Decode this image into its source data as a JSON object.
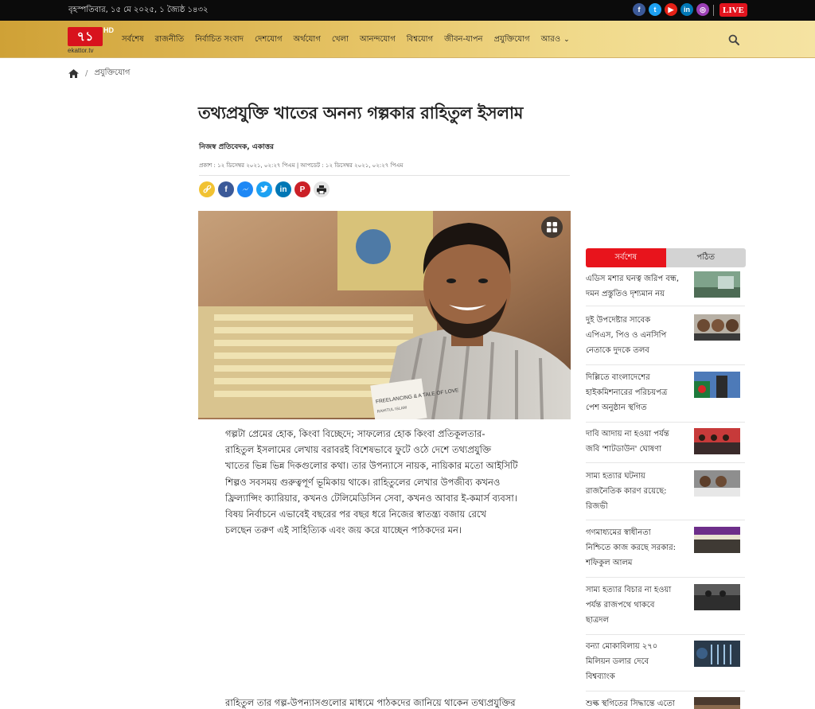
{
  "topbar": {
    "date": "বৃহস্পতিবার, ১৫ মে ২০২৫, ১ জ্যৈষ্ঠ ১৪৩২",
    "live_label": "LIVE",
    "social": [
      "f",
      "t",
      "▶",
      "in",
      "◎"
    ]
  },
  "logo": {
    "mark": "৭১",
    "hd": "HD",
    "sub": "ekattor.tv"
  },
  "nav": {
    "items": [
      "সর্বশেষ",
      "রাজনীতি",
      "নির্বাচিত সংবাদ",
      "দেশযোগ",
      "অর্থযোগ",
      "খেলা",
      "আনন্দযোগ",
      "বিশ্বযোগ",
      "জীবন-যাপন",
      "প্রযুক্তিযোগ",
      "আরও"
    ]
  },
  "breadcrumb": {
    "separator": "/",
    "current": "প্রযুক্তিযোগ"
  },
  "article": {
    "title": "তথ্যপ্রযুক্তি খাতের অনন্য গল্পকার রাহিতুল ইসলাম",
    "author": "নিজস্ব প্রতিবেদক, একাত্তর",
    "dates": "প্রকাশ : ১২ ডিসেম্বর ২০২১, ০২:২৭ পিএম  |  আপডেট : ১২ ডিসেম্বর ২০২১, ০২:২৭ পিএম",
    "book_text": "FREELANCING & A TALE OF LOVE",
    "book_author": "RAHITUL ISLAM",
    "body_lines": [
      "গল্পটা প্রেমের হোক, কিংবা বিচ্ছেদে; সাফল্যের হোক কিংবা প্রতিকূলতার-",
      "রাহিতুল ইসলামের লেখায় বরাবরই বিশেষভাবে ফুটে ওঠে দেশে তথ্যপ্রযুক্তি",
      "খাতের ভিন্ন ভিন্ন দিকগুলোর কথা। তার উপন্যাসে নায়ক, নায়িকার মতো আইসিটি",
      "শিল্পও সবসময় গুরুত্বপূর্ণ ভূমিকায় থাকে। রাহিতুলের লেখার উপজীব্য কখনও",
      "ফ্রিল্যান্সিং ক্যারিয়ার, কখনও টেলিমেডিসিন সেবা, কখনও আবার ই-কমার্স ব্যবসা।",
      "বিষয় নির্বাচনে এভাবেই বছরের পর বছর ধরে নিজের স্বাতন্ত্র্য বজায় রেখে",
      "চলছেন তরুণ এই সাহিত্যিক এবং জয় করে যাচ্ছেন পাঠকদের মন।"
    ],
    "body_continue": "রাহিতুল তার গল্প-উপন্যাসগুলোর মাধ্যমে পাঠকদের জানিয়ে থাকেন তথ্যপ্রযুক্তির"
  },
  "sidebar": {
    "tabs": [
      "সর্বশেষ",
      "পঠিত"
    ],
    "news": [
      {
        "lines": [
          "এডিস মশার ঘনত্ব জরিপ বন্ধ,",
          "দমন প্রস্তুতিও দৃশ্যমান নয়"
        ]
      },
      {
        "lines": [
          "দুই উপদেষ্টার সাবেক",
          "এপিএস, পিও ও এনসিপি",
          "নেতাকে দুদকে তলব"
        ]
      },
      {
        "lines": [
          "দিল্লিতে বাংলাদেশের",
          "হাইকমিশনারের পরিচয়পত্র",
          "পেশ অনুষ্ঠান স্থগিত"
        ]
      },
      {
        "lines": [
          "দাবি আদায় না হওয়া পর্যন্ত",
          "জবি 'শাটডাউন' ঘোষণা"
        ]
      },
      {
        "lines": [
          "সাম্য হত্যার ঘটনায়",
          "রাজনৈতিক কারণ রয়েছে:",
          "রিজভী"
        ]
      },
      {
        "lines": [
          "গণমাধ্যমের স্বাধীনতা",
          "নিশ্চিতে কাজ করছে সরকার:",
          "শফিকুল আলম"
        ]
      },
      {
        "lines": [
          "সাম্য হত্যার বিচার না হওয়া",
          "পর্যন্ত রাজপথে থাকবে",
          "ছাত্রদল"
        ]
      },
      {
        "lines": [
          "বন্যা মোকাবিলায় ২৭০",
          "মিলিয়ন ডলার দেবে",
          "বিশ্বব্যাংক"
        ]
      },
      {
        "lines": [
          "শুল্ক স্থগিতের সিদ্ধান্তে এতো"
        ]
      }
    ]
  },
  "colors": {
    "accent_red": "#e8141c",
    "nav_gold": "#e6c466"
  }
}
